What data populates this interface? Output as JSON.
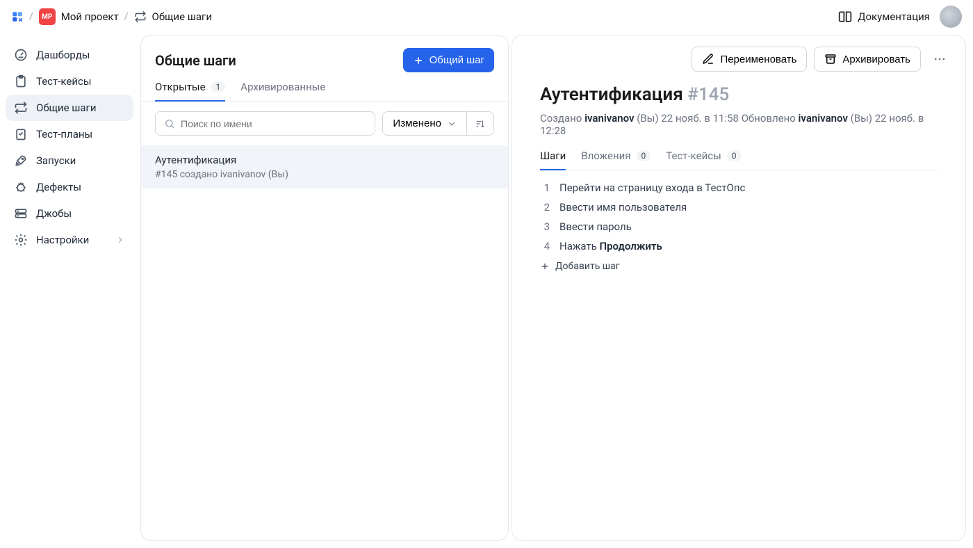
{
  "breadcrumb": {
    "project_abbr": "MP",
    "project_name": "Мой проект",
    "current": "Общие шаги"
  },
  "top": {
    "docs": "Документация"
  },
  "sidebar": {
    "items": [
      {
        "label": "Дашборды"
      },
      {
        "label": "Тест-кейсы"
      },
      {
        "label": "Общие шаги"
      },
      {
        "label": "Тест-планы"
      },
      {
        "label": "Запуски"
      },
      {
        "label": "Дефекты"
      },
      {
        "label": "Джобы"
      },
      {
        "label": "Настройки"
      }
    ]
  },
  "list": {
    "title": "Общие шаги",
    "create_btn": "Общий шаг",
    "tabs": {
      "open": "Открытые",
      "open_count": "1",
      "archived": "Архивированные"
    },
    "search_placeholder": "Поиск по имени",
    "sort_label": "Изменено",
    "items": [
      {
        "title": "Аутентификация",
        "sub": "#145 создано ivanivanov (Вы)"
      }
    ]
  },
  "detail": {
    "rename": "Переименовать",
    "archive": "Архивировать",
    "title": "Аутентификация",
    "id": "#145",
    "meta": {
      "created_label": "Создано",
      "created_user": "ivanivanov",
      "created_you": "(Вы)",
      "created_time": "22 нояб. в 11:58",
      "updated_label": "Обновлено",
      "updated_user": "ivanivanov",
      "updated_you": "(Вы)",
      "updated_time": "22 нояб. в 12:28"
    },
    "tabs": {
      "steps": "Шаги",
      "attachments": "Вложения",
      "attachments_count": "0",
      "testcases": "Тест-кейсы",
      "testcases_count": "0"
    },
    "steps": [
      {
        "n": "1",
        "text": "Перейти на страницу входа в ТестОпс"
      },
      {
        "n": "2",
        "text": "Ввести имя пользователя"
      },
      {
        "n": "3",
        "text": "Ввести пароль"
      },
      {
        "n": "4",
        "text": "Нажать ",
        "bold": "Продолжить"
      }
    ],
    "add_step": "Добавить шаг"
  }
}
